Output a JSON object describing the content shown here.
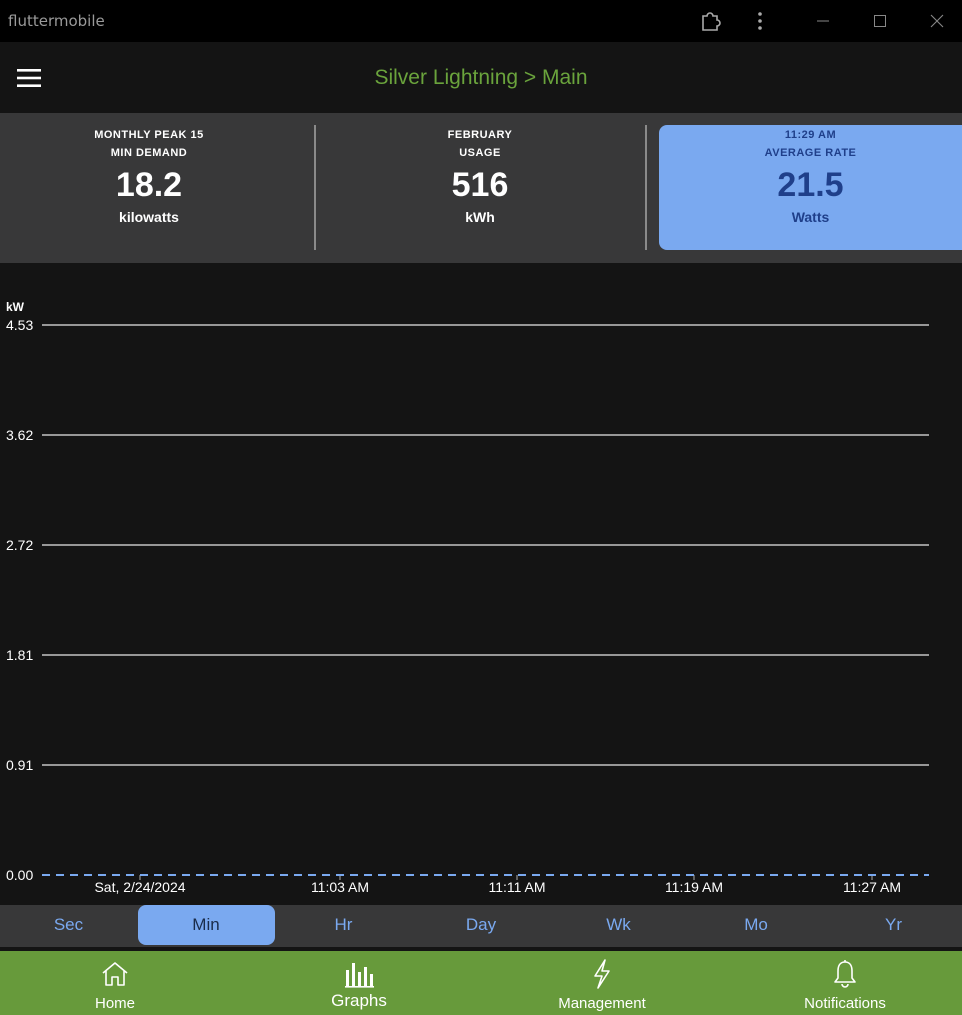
{
  "window": {
    "title": "fluttermobile"
  },
  "appbar": {
    "title": "Silver Lightning > Main"
  },
  "stats": [
    {
      "label_line1": "MONTHLY PEAK 15",
      "label_line2": "MIN DEMAND",
      "value": "18.2",
      "unit": "kilowatts"
    },
    {
      "label_line1": "FEBRUARY",
      "label_line2": "USAGE",
      "value": "516",
      "unit": "kWh"
    },
    {
      "label_line1": "11:29 AM",
      "label_line2": "AVERAGE RATE",
      "value": "21.5",
      "unit": "Watts"
    }
  ],
  "chart_data": {
    "type": "line",
    "ylabel": "kW",
    "yticks": [
      "4.53",
      "3.62",
      "2.72",
      "1.81",
      "0.91",
      "0.00"
    ],
    "ylim": [
      0,
      4.53
    ],
    "xticks": [
      "Sat, 2/24/2024",
      "11:03 AM",
      "11:11 AM",
      "11:19 AM",
      "11:27 AM"
    ],
    "grid": true,
    "series": [
      {
        "values": [
          0,
          0,
          0,
          0,
          0
        ],
        "color": "#7aa9f0",
        "style": "dashed"
      }
    ]
  },
  "ranges": [
    "Sec",
    "Min",
    "Hr",
    "Day",
    "Wk",
    "Mo",
    "Yr"
  ],
  "selected_range": "Min",
  "nav": [
    {
      "label": "Home",
      "icon": "home-icon"
    },
    {
      "label": "Graphs",
      "icon": "bar-chart-icon"
    },
    {
      "label": "Management",
      "icon": "lightning-icon"
    },
    {
      "label": "Notifications",
      "icon": "bell-icon"
    }
  ],
  "colors": {
    "accent_green": "#679a3b",
    "title_green": "#6aa33c",
    "accent_blue": "#7aa9f0",
    "card_bg": "#383839",
    "bg": "#141414"
  }
}
